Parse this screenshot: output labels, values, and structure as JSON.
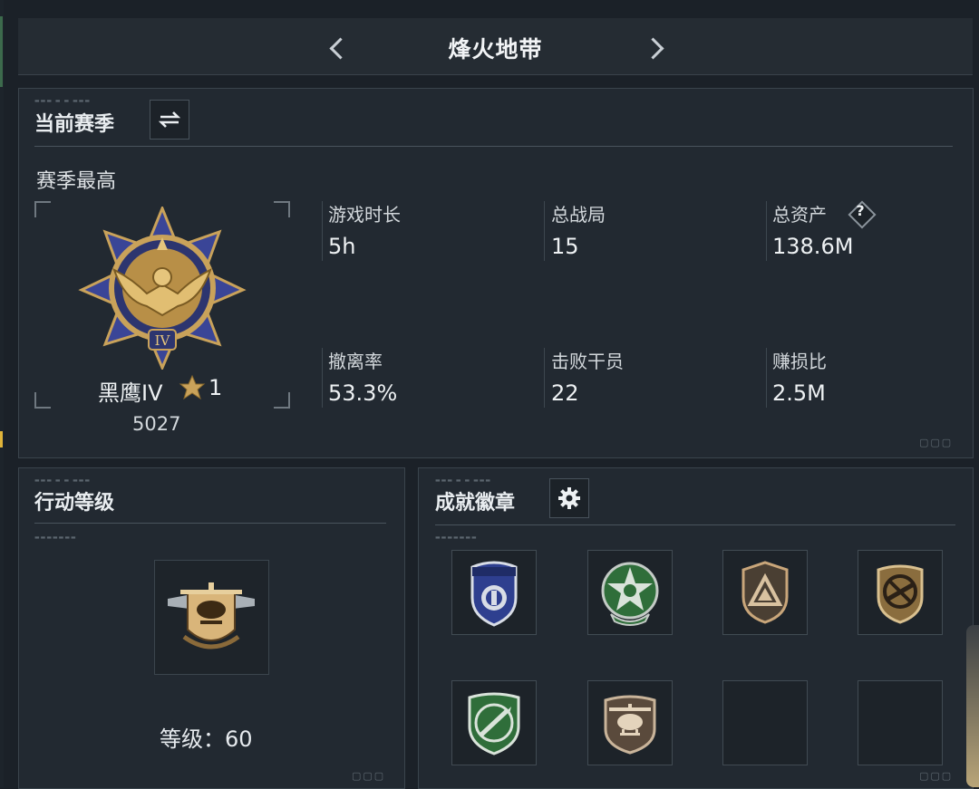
{
  "header": {
    "title": "烽火地带"
  },
  "season": {
    "title": "当前赛季",
    "subtitle": "赛季最高",
    "rank_name": "黑鹰IV",
    "rank_stars": "1",
    "rank_points": "5027",
    "stats": [
      {
        "label": "游戏时长",
        "value": "5h"
      },
      {
        "label": "总战局",
        "value": "15"
      },
      {
        "label": "总资产",
        "value": "138.6M"
      },
      {
        "label": "撤离率",
        "value": "53.3%"
      },
      {
        "label": "击败干员",
        "value": "22"
      },
      {
        "label": "赚损比",
        "value": "2.5M"
      }
    ],
    "help_icon_label": "?"
  },
  "action_level": {
    "title": "行动等级",
    "level_text": "等级：60"
  },
  "achievements": {
    "title": "成就徽章"
  },
  "colors": {
    "panel_bg": "#222931",
    "page_bg": "#1b2128",
    "gold": "#c9a25a",
    "accent_left": "#e0b43a"
  }
}
